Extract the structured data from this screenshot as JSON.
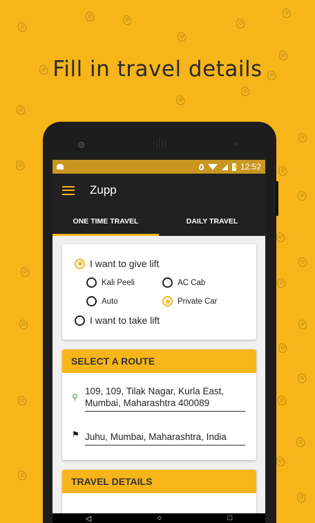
{
  "headline": "Fill in travel details",
  "status": {
    "time": "12:52"
  },
  "appbar": {
    "title": "Zupp"
  },
  "tabs": [
    {
      "label": "ONE TIME TRAVEL",
      "active": true
    },
    {
      "label": "DAILY TRAVEL",
      "active": false
    }
  ],
  "mode": {
    "give_lift": {
      "label": "I want to give lift",
      "selected": true
    },
    "take_lift": {
      "label": "I want to take lift",
      "selected": false
    },
    "vehicles": [
      {
        "label": "Kali Peeli",
        "selected": false
      },
      {
        "label": "AC Cab",
        "selected": false
      },
      {
        "label": "Auto",
        "selected": false
      },
      {
        "label": "Private Car",
        "selected": true
      }
    ]
  },
  "route": {
    "header": "SELECT A ROUTE",
    "from": "109, 109, Tilak Nagar, Kurla East, Mumbai, Maharashtra 400089",
    "to": "Juhu, Mumbai, Maharashtra, India"
  },
  "travel_details": {
    "header": "TRAVEL DETAILS"
  },
  "colors": {
    "accent": "#f7b51a",
    "dark": "#212121",
    "statusbar": "#c9971f"
  },
  "icons": [
    "menu-icon",
    "location-pin-icon",
    "finish-flag-icon",
    "back-icon",
    "home-icon",
    "recents-icon"
  ]
}
